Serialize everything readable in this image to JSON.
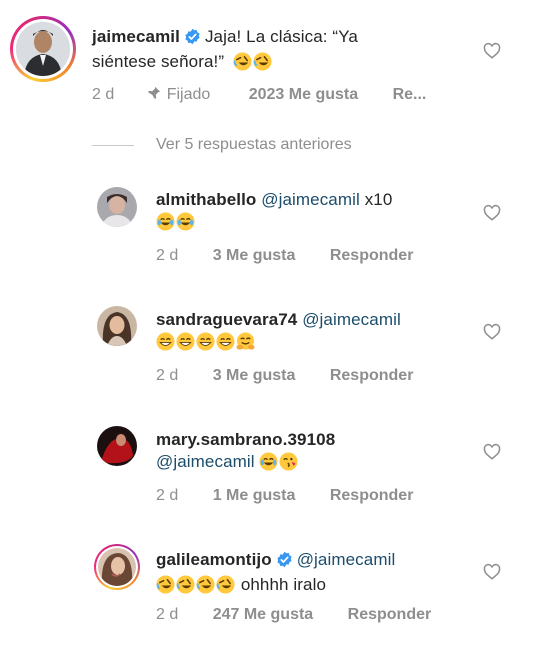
{
  "main_comment": {
    "username": "jaimecamil",
    "text": "Jaja! La clásica: “Ya",
    "text_line2": "siéntese señora!”",
    "emojis": [
      "rofl",
      "rofl"
    ],
    "time": "2 d",
    "pinned_label": "Fijado",
    "likes": "2023 Me gusta",
    "reply_truncated": "Re..."
  },
  "view_replies_label": "Ver 5 respuestas anteriores",
  "replies": [
    {
      "username": "almithabello",
      "mention": "@jaimecamil",
      "text": "x10",
      "emojis": [
        "joy",
        "joy"
      ],
      "time": "2 d",
      "likes": "3 Me gusta",
      "reply_label": "Responder",
      "verified": false
    },
    {
      "username": "sandraguevara74",
      "mention": "@jaimecamil",
      "text": "",
      "emojis": [
        "grin",
        "grin",
        "grin",
        "grin",
        "hug"
      ],
      "time": "2 d",
      "likes": "3 Me gusta",
      "reply_label": "Responder",
      "verified": false
    },
    {
      "username": "mary.sambrano.39108",
      "mention": "@jaimecamil",
      "text": "",
      "emojis": [
        "joy",
        "kiss"
      ],
      "time": "2 d",
      "likes": "1 Me gusta",
      "reply_label": "Responder",
      "verified": false
    },
    {
      "username": "galileamontijo",
      "mention": "@jaimecamil",
      "text": "ohhhh iralo",
      "emojis": [
        "rofl",
        "rofl",
        "rofl",
        "rofl"
      ],
      "time": "2 d",
      "likes": "247 Me gusta",
      "reply_label": "Responder",
      "verified": true
    }
  ],
  "colors": {
    "verified_blue": "#3897f0",
    "mention": "#1c4d6b",
    "meta_gray": "#8e8e8e",
    "emoji_yellow": "#ffc83d"
  },
  "icons": [
    "verified-badge-icon",
    "pin-icon",
    "heart-outline-icon"
  ]
}
